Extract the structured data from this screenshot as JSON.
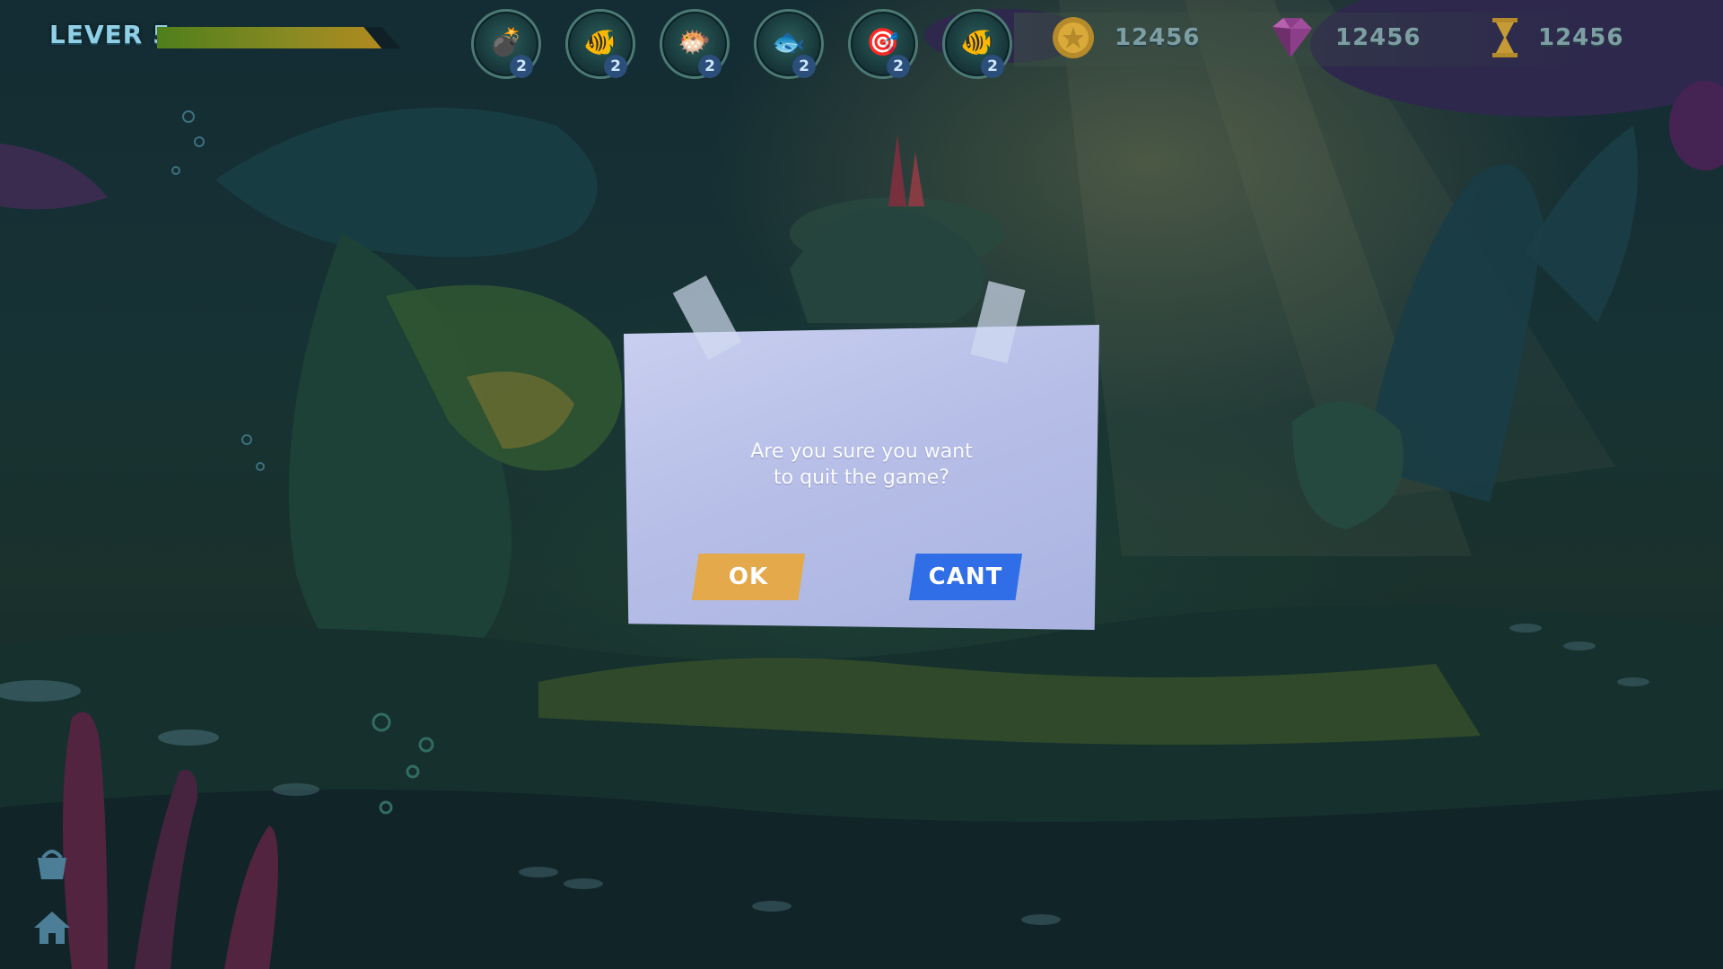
{
  "hud": {
    "level_label": "LEVER 5",
    "level_progress": 0.92,
    "powerups": [
      {
        "icon": "bomb-icon",
        "glyph": "💣",
        "count": "2"
      },
      {
        "icon": "gold-fish-x2-icon",
        "glyph": "🐠",
        "count": "2"
      },
      {
        "icon": "orange-fish-icon",
        "glyph": "🐡",
        "count": "2"
      },
      {
        "icon": "red-fish-icon",
        "glyph": "🐟",
        "count": "2"
      },
      {
        "icon": "lifebuoy-icon",
        "glyph": "🎯",
        "count": "2"
      },
      {
        "icon": "gold-fish-x2-icon",
        "glyph": "🐠",
        "count": "2"
      }
    ],
    "coins": "12456",
    "gems": "12456",
    "time": "12456"
  },
  "dialog": {
    "message_line1": "Are you sure you want",
    "message_line2": "to quit the game?",
    "ok_label": "OK",
    "cancel_label": "CANT"
  },
  "colors": {
    "ok_button": "#e4a94a",
    "cancel_button": "#2f6ee6",
    "dialog_paper": "#b7bfe8"
  }
}
